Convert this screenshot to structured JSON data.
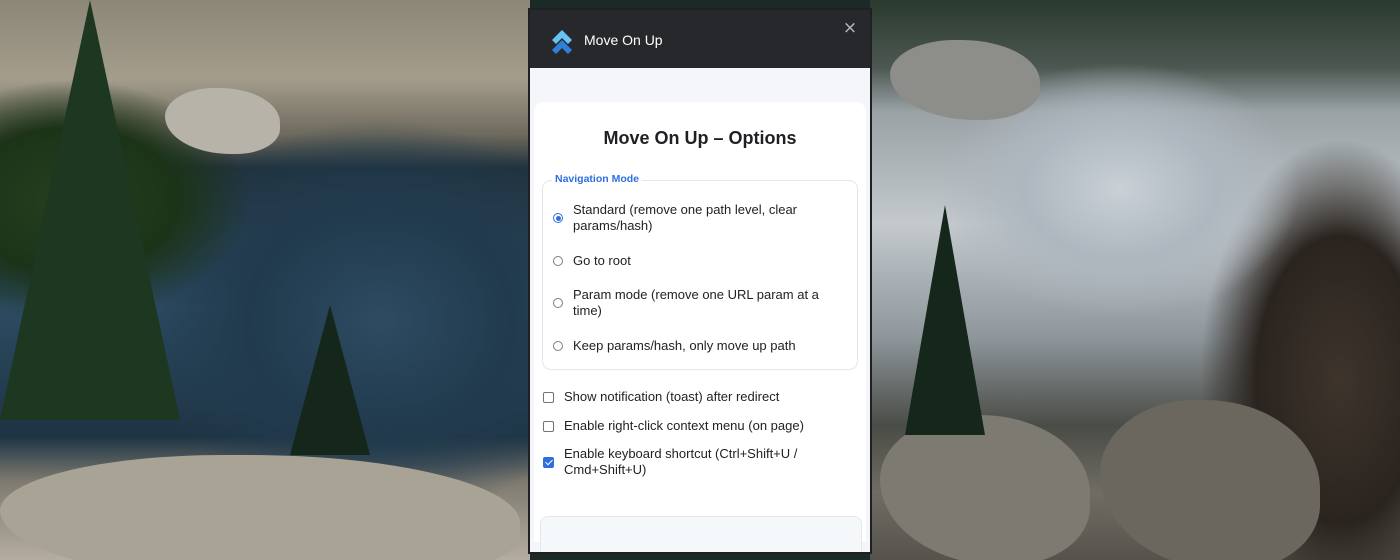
{
  "window": {
    "app_title": "Move On Up",
    "close_glyph": "×"
  },
  "page": {
    "title": "Move On Up – Options"
  },
  "navigation_mode": {
    "legend": "Navigation Mode",
    "options": [
      {
        "label": "Standard (remove one path level, clear params/hash)",
        "checked": true
      },
      {
        "label": "Go to root",
        "checked": false
      },
      {
        "label": "Param mode (remove one URL param at a time)",
        "checked": false
      },
      {
        "label": "Keep params/hash, only move up path",
        "checked": false
      }
    ]
  },
  "settings": [
    {
      "label": "Show notification (toast) after redirect",
      "checked": false
    },
    {
      "label": "Enable right-click context menu (on page)",
      "checked": false
    },
    {
      "label": "Enable keyboard shortcut (Ctrl+Shift+U / Cmd+Shift+U)",
      "checked": true
    }
  ],
  "colors": {
    "accent": "#2f6fdd",
    "logo_light": "#66c3f2",
    "logo_dark": "#2f80d9",
    "titlebar": "#27282c"
  },
  "icons": {
    "logo": "double-chevron-up-icon",
    "close": "close-icon"
  }
}
